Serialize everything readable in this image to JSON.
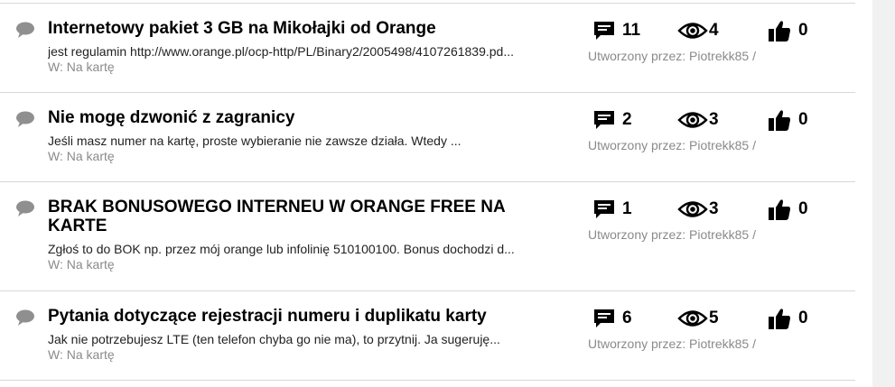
{
  "threads": [
    {
      "title": "Internetowy pakiet 3 GB na Mikołajki od Orange",
      "excerpt": "jest regulamin http://www.orange.pl/ocp-http/PL/Binary2/2005498/4107261839.pd...",
      "board": "W: Na kartę",
      "replies": "11",
      "views": "4",
      "likes": "0",
      "creator": "Utworzony przez: Piotrekk85 /"
    },
    {
      "title": "Nie mogę dzwonić z zagranicy",
      "excerpt": "Jeśli masz numer na kartę, proste wybieranie nie zawsze działa.   Wtedy ...",
      "board": "W: Na kartę",
      "replies": "2",
      "views": "3",
      "likes": "0",
      "creator": "Utworzony przez: Piotrekk85 /"
    },
    {
      "title": "BRAK BONUSOWEGO INTERNEU W ORANGE FREE NA KARTE",
      "excerpt": "Zgłoś to do BOK np. przez mój orange lub infolinię 510100100. Bonus dochodzi d...",
      "board": "W: Na kartę",
      "replies": "1",
      "views": "3",
      "likes": "0",
      "creator": "Utworzony przez: Piotrekk85 /"
    },
    {
      "title": "Pytania dotyczące rejestracji numeru i duplikatu karty",
      "excerpt": "Jak nie potrzebujesz LTE (ten telefon chyba go nie ma), to przytnij. Ja sugeruję...",
      "board": "W: Na kartę",
      "replies": "6",
      "views": "5",
      "likes": "0",
      "creator": "Utworzony przez: Piotrekk85 /"
    }
  ],
  "icons": {
    "thread": "speech-bubble-icon",
    "replies": "comment-icon",
    "views": "eye-icon",
    "likes": "thumbs-up-icon"
  },
  "colors": {
    "title": "#000000",
    "muted": "#8a8a8a",
    "divider": "#d8d8d8",
    "bubble": "#8f8f8f"
  }
}
